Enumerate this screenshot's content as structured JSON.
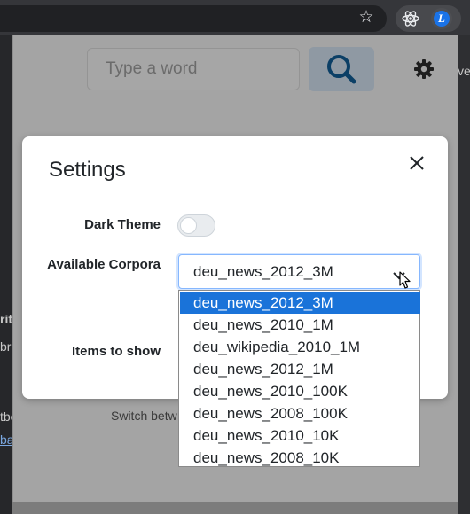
{
  "browser": {
    "star_icon": "star-icon",
    "extensions": [
      "react-devtools-icon",
      "leo-extension-icon"
    ],
    "leo_letter": "L"
  },
  "popup": {
    "search_placeholder": "Type a word",
    "hint_text": "Switch betw",
    "colors": {
      "search_button": "#8f99a3",
      "dim_overlay": "#a4a4a4"
    }
  },
  "background_page": {
    "fragments": [
      "rit",
      "br",
      "tbo",
      "ba",
      "ve"
    ]
  },
  "modal": {
    "title": "Settings",
    "dark_theme_label": "Dark Theme",
    "dark_theme_on": false,
    "corpora_label": "Available Corpora",
    "corpora_selected": "deu_news_2012_3M",
    "items_label": "Items to show",
    "corpora_options": [
      "deu_news_2012_3M",
      "deu_news_2010_1M",
      "deu_wikipedia_2010_1M",
      "deu_news_2012_1M",
      "deu_news_2010_100K",
      "deu_news_2008_100K",
      "deu_news_2010_10K",
      "deu_news_2008_10K"
    ],
    "colors": {
      "highlight": "#1a73d9",
      "focus_border": "#86b7fe"
    }
  }
}
